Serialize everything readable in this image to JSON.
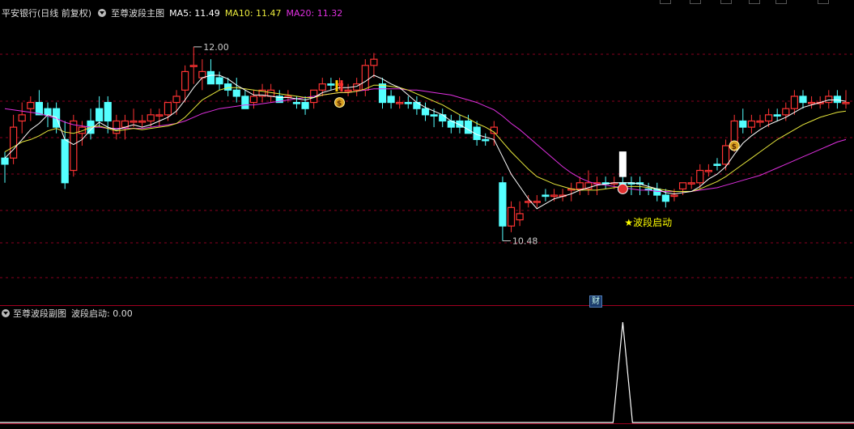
{
  "header": {
    "stock_name": "平安银行(日线 前复权)",
    "indicator_name": "至尊波段主图",
    "ma5_label": "MA5: 11.49",
    "ma10_label": "MA10: 11.47",
    "ma20_label": "MA20: 11.32"
  },
  "colors": {
    "up": "#ff3333",
    "down": "#54ffff",
    "ma5": "#ffffff",
    "ma10": "#e8e83c",
    "ma20": "#e030e0",
    "signal": "#ffff00",
    "grid": "#8a0020"
  },
  "annotations": {
    "high_label": "12.00",
    "low_label": "10.48",
    "signal_label": "★波段启动"
  },
  "sub": {
    "title": "至尊波段副图",
    "value_label": "波段启动: 0.00",
    "badge": "财"
  },
  "chart_data": {
    "type": "candlestick",
    "y_range": [
      10.3,
      12.2
    ],
    "candles": [
      [
        11.1,
        11.2,
        10.95,
        11.15,
        "down"
      ],
      [
        11.4,
        11.5,
        11.1,
        11.15,
        "up"
      ],
      [
        11.45,
        11.6,
        11.35,
        11.5,
        "up"
      ],
      [
        11.55,
        11.65,
        11.45,
        11.6,
        "up"
      ],
      [
        11.6,
        11.7,
        11.5,
        11.5,
        "down"
      ],
      [
        11.5,
        11.6,
        11.4,
        11.55,
        "down"
      ],
      [
        11.55,
        11.6,
        11.35,
        11.4,
        "down"
      ],
      [
        11.3,
        11.45,
        10.9,
        10.95,
        "down"
      ],
      [
        11.05,
        11.5,
        11.0,
        11.45,
        "up"
      ],
      [
        11.35,
        11.45,
        11.25,
        11.4,
        "up"
      ],
      [
        11.45,
        11.55,
        11.3,
        11.35,
        "down"
      ],
      [
        11.55,
        11.65,
        11.4,
        11.45,
        "down"
      ],
      [
        11.6,
        11.65,
        11.35,
        11.45,
        "down"
      ],
      [
        11.45,
        11.5,
        11.3,
        11.35,
        "up"
      ],
      [
        11.45,
        11.5,
        11.3,
        11.4,
        "up"
      ],
      [
        11.45,
        11.55,
        11.4,
        11.45,
        "up"
      ],
      [
        11.45,
        11.5,
        11.4,
        11.45,
        "up"
      ],
      [
        11.45,
        11.55,
        11.4,
        11.5,
        "up"
      ],
      [
        11.5,
        11.55,
        11.4,
        11.5,
        "up"
      ],
      [
        11.5,
        11.6,
        11.45,
        11.6,
        "up"
      ],
      [
        11.6,
        11.7,
        11.5,
        11.65,
        "up"
      ],
      [
        11.7,
        11.9,
        11.6,
        11.85,
        "up"
      ],
      [
        11.9,
        12.05,
        11.75,
        11.9,
        "up"
      ],
      [
        11.8,
        11.95,
        11.7,
        11.85,
        "up"
      ],
      [
        11.85,
        11.95,
        11.75,
        11.75,
        "down"
      ],
      [
        11.8,
        11.85,
        11.7,
        11.75,
        "down"
      ],
      [
        11.75,
        11.8,
        11.65,
        11.7,
        "down"
      ],
      [
        11.7,
        11.8,
        11.6,
        11.65,
        "down"
      ],
      [
        11.65,
        11.7,
        11.55,
        11.55,
        "down"
      ],
      [
        11.6,
        11.7,
        11.55,
        11.65,
        "up"
      ],
      [
        11.65,
        11.75,
        11.6,
        11.7,
        "up"
      ],
      [
        11.7,
        11.75,
        11.6,
        11.65,
        "up"
      ],
      [
        11.65,
        11.7,
        11.6,
        11.6,
        "down"
      ],
      [
        11.65,
        11.7,
        11.6,
        11.65,
        "up"
      ],
      [
        11.6,
        11.65,
        11.55,
        11.6,
        "down"
      ],
      [
        11.6,
        11.65,
        11.5,
        11.55,
        "down"
      ],
      [
        11.6,
        11.7,
        11.55,
        11.7,
        "up"
      ],
      [
        11.7,
        11.8,
        11.65,
        11.75,
        "up"
      ],
      [
        11.75,
        11.8,
        11.7,
        11.75,
        "down"
      ],
      [
        11.75,
        11.8,
        11.7,
        11.75,
        "up"
      ],
      [
        11.7,
        11.75,
        11.65,
        11.7,
        "up"
      ],
      [
        11.7,
        11.8,
        11.65,
        11.75,
        "up"
      ],
      [
        11.7,
        11.95,
        11.65,
        11.9,
        "up"
      ],
      [
        11.9,
        12.0,
        11.8,
        11.95,
        "up"
      ],
      [
        11.75,
        11.8,
        11.55,
        11.6,
        "down"
      ],
      [
        11.6,
        11.7,
        11.55,
        11.65,
        "down"
      ],
      [
        11.6,
        11.65,
        11.55,
        11.6,
        "up"
      ],
      [
        11.6,
        11.65,
        11.55,
        11.6,
        "down"
      ],
      [
        11.6,
        11.65,
        11.5,
        11.55,
        "down"
      ],
      [
        11.5,
        11.6,
        11.45,
        11.55,
        "down"
      ],
      [
        11.5,
        11.55,
        11.4,
        11.5,
        "down"
      ],
      [
        11.5,
        11.55,
        11.4,
        11.45,
        "down"
      ],
      [
        11.45,
        11.5,
        11.35,
        11.4,
        "down"
      ],
      [
        11.45,
        11.5,
        11.35,
        11.4,
        "down"
      ],
      [
        11.45,
        11.5,
        11.35,
        11.35,
        "down"
      ],
      [
        11.4,
        11.45,
        11.25,
        11.3,
        "down"
      ],
      [
        11.3,
        11.35,
        11.25,
        11.3,
        "down"
      ],
      [
        11.35,
        11.45,
        11.25,
        11.4,
        "up"
      ],
      [
        10.95,
        11.0,
        10.48,
        10.6,
        "down"
      ],
      [
        10.6,
        10.8,
        10.55,
        10.75,
        "up"
      ],
      [
        10.65,
        10.8,
        10.6,
        10.7,
        "up"
      ],
      [
        10.8,
        10.85,
        10.75,
        10.8,
        "up"
      ],
      [
        10.8,
        10.85,
        10.75,
        10.8,
        "up"
      ],
      [
        10.85,
        10.9,
        10.8,
        10.85,
        "down"
      ],
      [
        10.85,
        10.9,
        10.8,
        10.85,
        "up"
      ],
      [
        10.85,
        10.9,
        10.8,
        10.85,
        "up"
      ],
      [
        10.9,
        10.95,
        10.8,
        10.9,
        "up"
      ],
      [
        10.9,
        11.0,
        10.85,
        10.95,
        "up"
      ],
      [
        10.95,
        11.05,
        10.85,
        10.9,
        "up"
      ],
      [
        10.95,
        11.0,
        10.85,
        10.95,
        "up"
      ],
      [
        10.95,
        11.0,
        10.9,
        10.95,
        "down"
      ],
      [
        10.95,
        11.0,
        10.9,
        10.95,
        "up"
      ],
      [
        10.95,
        11.0,
        10.9,
        10.95,
        "down"
      ],
      [
        10.95,
        11.0,
        10.85,
        10.95,
        "down"
      ],
      [
        10.95,
        11.0,
        10.85,
        10.95,
        "down"
      ],
      [
        10.9,
        10.95,
        10.85,
        10.9,
        "down"
      ],
      [
        10.9,
        10.95,
        10.8,
        10.85,
        "down"
      ],
      [
        10.85,
        10.9,
        10.75,
        10.8,
        "down"
      ],
      [
        10.85,
        10.9,
        10.8,
        10.85,
        "up"
      ],
      [
        10.9,
        10.95,
        10.85,
        10.95,
        "up"
      ],
      [
        10.95,
        11.0,
        10.9,
        10.95,
        "up"
      ],
      [
        10.95,
        11.1,
        10.9,
        11.05,
        "up"
      ],
      [
        11.05,
        11.1,
        11.0,
        11.05,
        "up"
      ],
      [
        11.1,
        11.15,
        11.05,
        11.1,
        "down"
      ],
      [
        11.1,
        11.3,
        11.05,
        11.25,
        "up"
      ],
      [
        11.25,
        11.5,
        11.2,
        11.45,
        "up"
      ],
      [
        11.45,
        11.55,
        11.35,
        11.4,
        "down"
      ],
      [
        11.4,
        11.5,
        11.35,
        11.45,
        "up"
      ],
      [
        11.45,
        11.5,
        11.4,
        11.45,
        "up"
      ],
      [
        11.45,
        11.55,
        11.4,
        11.5,
        "up"
      ],
      [
        11.5,
        11.55,
        11.45,
        11.5,
        "down"
      ],
      [
        11.5,
        11.6,
        11.45,
        11.55,
        "up"
      ],
      [
        11.55,
        11.7,
        11.5,
        11.65,
        "up"
      ],
      [
        11.65,
        11.7,
        11.55,
        11.6,
        "down"
      ],
      [
        11.6,
        11.65,
        11.55,
        11.6,
        "up"
      ],
      [
        11.6,
        11.65,
        11.55,
        11.6,
        "up"
      ],
      [
        11.6,
        11.7,
        11.55,
        11.65,
        "up"
      ],
      [
        11.65,
        11.7,
        11.55,
        11.6,
        "down"
      ],
      [
        11.6,
        11.7,
        11.55,
        11.6,
        "up"
      ]
    ],
    "ma5": [
      11.15,
      11.22,
      11.3,
      11.38,
      11.43,
      11.5,
      11.48,
      11.3,
      11.26,
      11.3,
      11.38,
      11.44,
      11.4,
      11.38,
      11.4,
      11.42,
      11.4,
      11.42,
      11.45,
      11.48,
      11.53,
      11.62,
      11.72,
      11.8,
      11.82,
      11.82,
      11.79,
      11.74,
      11.7,
      11.66,
      11.66,
      11.65,
      11.64,
      11.64,
      11.63,
      11.62,
      11.64,
      11.68,
      11.7,
      11.72,
      11.72,
      11.73,
      11.77,
      11.82,
      11.79,
      11.75,
      11.72,
      11.66,
      11.6,
      11.56,
      11.53,
      11.5,
      11.45,
      11.42,
      11.38,
      11.34,
      11.32,
      11.3,
      11.16,
      11.02,
      10.92,
      10.82,
      10.74,
      10.78,
      10.82,
      10.84,
      10.86,
      10.89,
      10.91,
      10.93,
      10.94,
      10.95,
      10.95,
      10.95,
      10.94,
      10.92,
      10.9,
      10.87,
      10.86,
      10.87,
      10.88,
      10.92,
      10.98,
      11.02,
      11.08,
      11.18,
      11.27,
      11.33,
      11.38,
      11.42,
      11.45,
      11.48,
      11.52,
      11.56,
      11.58,
      11.6,
      11.62,
      11.62,
      11.61
    ],
    "ma10": [
      11.2,
      11.24,
      11.28,
      11.3,
      11.33,
      11.37,
      11.39,
      11.36,
      11.35,
      11.37,
      11.4,
      11.41,
      11.39,
      11.37,
      11.38,
      11.39,
      11.38,
      11.39,
      11.4,
      11.41,
      11.43,
      11.48,
      11.55,
      11.62,
      11.66,
      11.7,
      11.72,
      11.72,
      11.71,
      11.7,
      11.69,
      11.68,
      11.67,
      11.66,
      11.65,
      11.64,
      11.64,
      11.66,
      11.67,
      11.68,
      11.68,
      11.69,
      11.71,
      11.74,
      11.74,
      11.73,
      11.72,
      11.7,
      11.67,
      11.64,
      11.61,
      11.58,
      11.54,
      11.5,
      11.47,
      11.43,
      11.4,
      11.36,
      11.28,
      11.2,
      11.13,
      11.06,
      11.0,
      10.97,
      10.94,
      10.92,
      10.9,
      10.89,
      10.89,
      10.89,
      10.9,
      10.91,
      10.92,
      10.92,
      10.92,
      10.91,
      10.9,
      10.89,
      10.88,
      10.88,
      10.88,
      10.9,
      10.93,
      10.96,
      11.0,
      11.05,
      11.1,
      11.15,
      11.2,
      11.25,
      11.3,
      11.34,
      11.38,
      11.42,
      11.45,
      11.48,
      11.5,
      11.52,
      11.53
    ],
    "ma20": [
      11.55,
      11.54,
      11.53,
      11.52,
      11.51,
      11.49,
      11.47,
      11.44,
      11.42,
      11.41,
      11.4,
      11.4,
      11.39,
      11.39,
      11.39,
      11.39,
      11.39,
      11.4,
      11.41,
      11.42,
      11.43,
      11.45,
      11.48,
      11.51,
      11.53,
      11.55,
      11.56,
      11.57,
      11.58,
      11.58,
      11.59,
      11.6,
      11.61,
      11.62,
      11.63,
      11.64,
      11.65,
      11.66,
      11.67,
      11.68,
      11.68,
      11.69,
      11.7,
      11.71,
      11.71,
      11.71,
      11.71,
      11.7,
      11.7,
      11.69,
      11.68,
      11.67,
      11.66,
      11.64,
      11.62,
      11.6,
      11.57,
      11.54,
      11.49,
      11.43,
      11.38,
      11.32,
      11.26,
      11.2,
      11.14,
      11.08,
      11.03,
      10.99,
      10.96,
      10.94,
      10.93,
      10.92,
      10.91,
      10.9,
      10.89,
      10.89,
      10.88,
      10.88,
      10.88,
      10.88,
      10.88,
      10.89,
      10.9,
      10.91,
      10.93,
      10.95,
      10.97,
      10.99,
      11.01,
      11.04,
      11.07,
      11.1,
      11.13,
      11.16,
      11.19,
      11.22,
      11.25,
      11.28,
      11.3
    ],
    "sub_spike_index": 72
  }
}
